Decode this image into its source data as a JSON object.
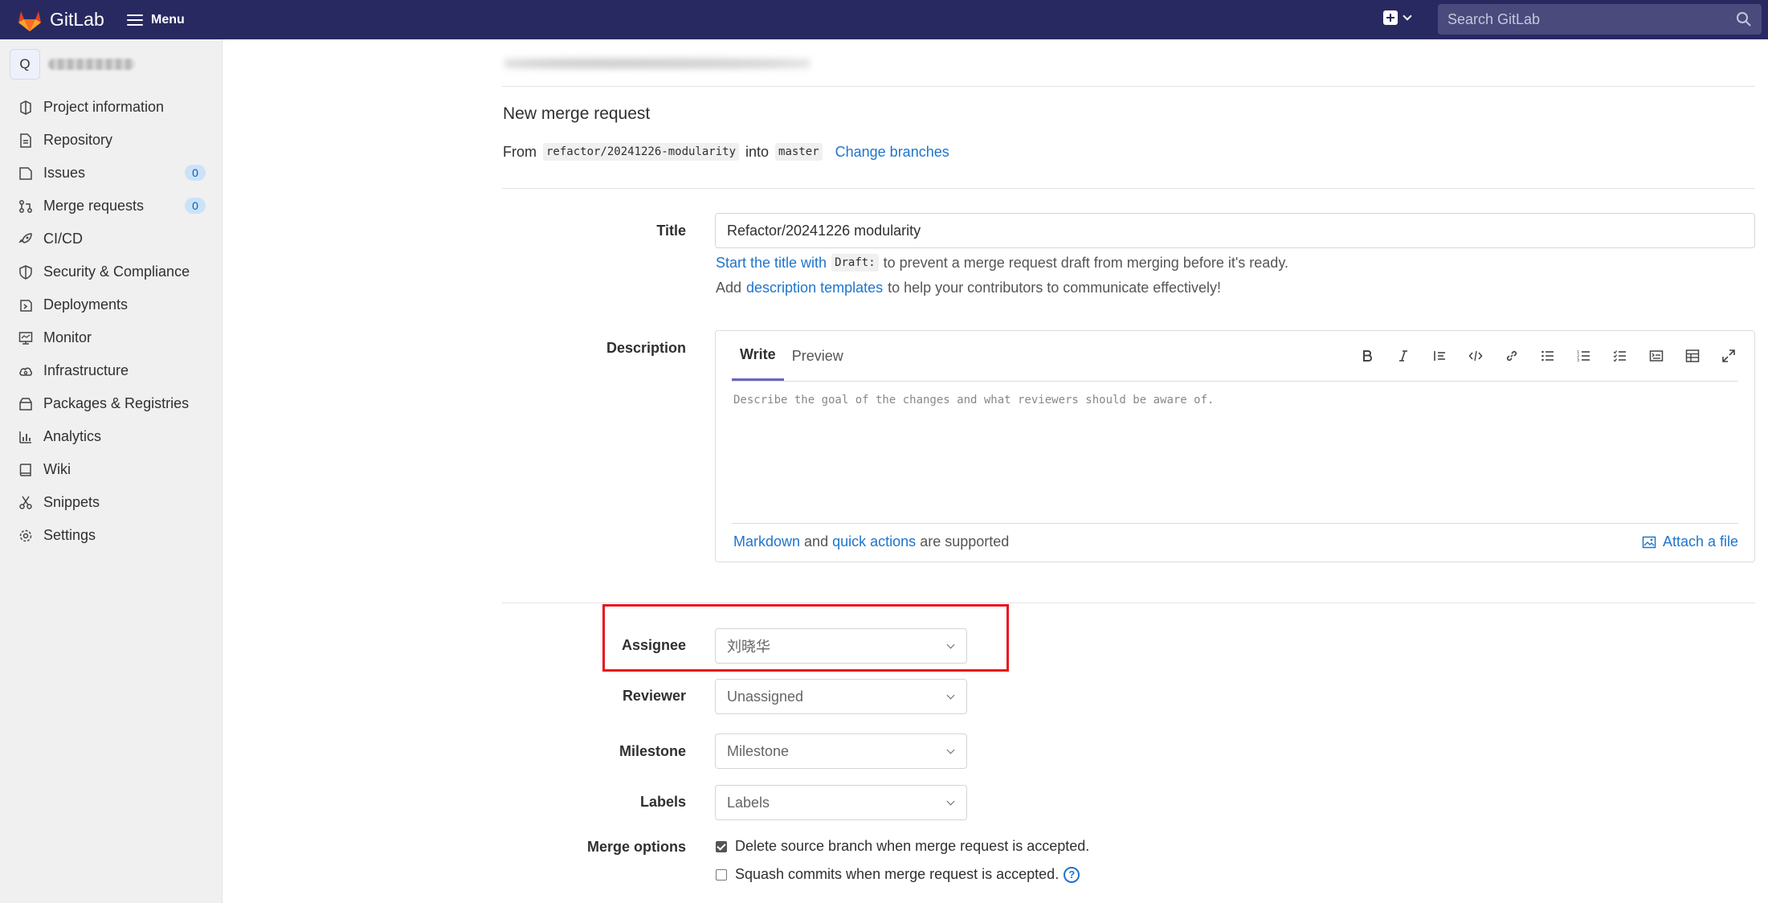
{
  "topbar": {
    "brand": "GitLab",
    "menu_label": "Menu",
    "search_placeholder": "Search GitLab"
  },
  "sidebar": {
    "avatar_letter": "Q",
    "items": [
      {
        "label": "Project information",
        "icon": "project-info-icon"
      },
      {
        "label": "Repository",
        "icon": "repository-icon"
      },
      {
        "label": "Issues",
        "icon": "issues-icon",
        "count": "0"
      },
      {
        "label": "Merge requests",
        "icon": "merge-request-icon",
        "count": "0"
      },
      {
        "label": "CI/CD",
        "icon": "rocket-icon"
      },
      {
        "label": "Security & Compliance",
        "icon": "shield-icon"
      },
      {
        "label": "Deployments",
        "icon": "deployments-icon"
      },
      {
        "label": "Monitor",
        "icon": "monitor-icon"
      },
      {
        "label": "Infrastructure",
        "icon": "cloud-gear-icon"
      },
      {
        "label": "Packages & Registries",
        "icon": "package-icon"
      },
      {
        "label": "Analytics",
        "icon": "chart-icon"
      },
      {
        "label": "Wiki",
        "icon": "book-icon"
      },
      {
        "label": "Snippets",
        "icon": "scissors-icon"
      },
      {
        "label": "Settings",
        "icon": "gear-icon"
      }
    ]
  },
  "main": {
    "title": "New merge request",
    "from_word": "From",
    "source_branch": "refactor/20241226-modularity",
    "into_word": "into",
    "target_branch": "master",
    "change_branches": "Change branches"
  },
  "form": {
    "title_label": "Title",
    "title_value": "Refactor/20241226 modularity",
    "draft_hint_link": "Start the title with",
    "draft_code": "Draft:",
    "draft_hint_rest": "to prevent a merge request draft from merging before it's ready.",
    "templates_add": "Add",
    "templates_link": "description templates",
    "templates_rest": "to help your contributors to communicate effectively!",
    "description_label": "Description",
    "tab_write": "Write",
    "tab_preview": "Preview",
    "description_placeholder": "Describe the goal of the changes and what reviewers should be aware of.",
    "markdown_link": "Markdown",
    "and_word": "and",
    "quick_actions_link": "quick actions",
    "supported_text": "are supported",
    "attach_label": "Attach a file",
    "assignee_label": "Assignee",
    "assignee_value": "刘晓华",
    "reviewer_label": "Reviewer",
    "reviewer_value": "Unassigned",
    "milestone_label": "Milestone",
    "milestone_value": "Milestone",
    "labels_label": "Labels",
    "labels_value": "Labels",
    "merge_options_label": "Merge options",
    "delete_branch_label": "Delete source branch when merge request is accepted.",
    "delete_branch_checked": true,
    "squash_label": "Squash commits when merge request is accepted.",
    "squash_checked": false
  },
  "colors": {
    "topbar": "#292961",
    "link": "#1f75cb",
    "highlight": "#e8141b"
  }
}
